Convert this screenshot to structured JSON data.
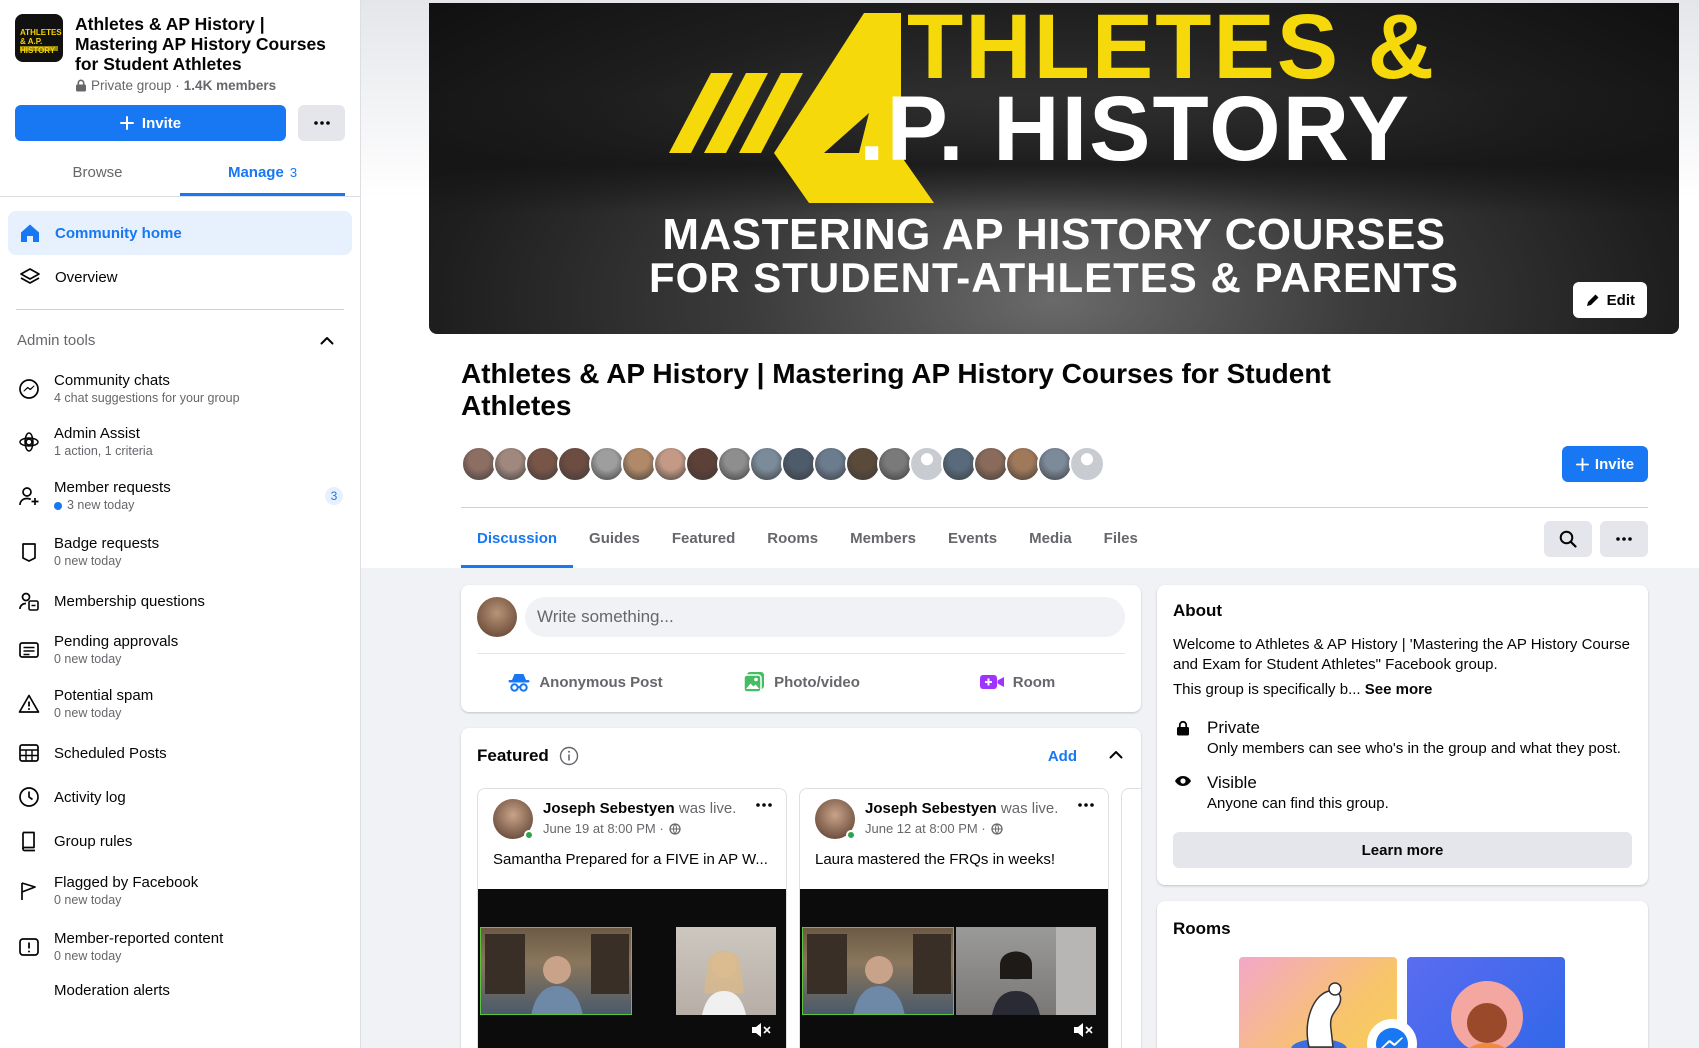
{
  "group": {
    "title": "Athletes & AP History | Mastering AP History Courses for Student Athletes",
    "privacy": "Private group",
    "members": "1.4K members",
    "thumb_text": "ATHLETES & A.P. HISTORY"
  },
  "sidebar": {
    "invite_label": "Invite",
    "tabs": [
      {
        "label": "Browse"
      },
      {
        "label": "Manage",
        "count": "3"
      }
    ],
    "nav": [
      {
        "label": "Community home"
      },
      {
        "label": "Overview"
      }
    ],
    "admin_tools_label": "Admin tools",
    "tools": [
      {
        "label": "Community chats",
        "sub": "4 chat suggestions for your group"
      },
      {
        "label": "Admin Assist",
        "sub": "1 action, 1 criteria"
      },
      {
        "label": "Member requests",
        "sub": "3 new today",
        "badge": "3"
      },
      {
        "label": "Badge requests",
        "sub": "0 new today"
      },
      {
        "label": "Membership questions"
      },
      {
        "label": "Pending approvals",
        "sub": "0 new today"
      },
      {
        "label": "Potential spam",
        "sub": "0 new today"
      },
      {
        "label": "Scheduled Posts"
      },
      {
        "label": "Activity log"
      },
      {
        "label": "Group rules"
      },
      {
        "label": "Flagged by Facebook",
        "sub": "0 new today"
      },
      {
        "label": "Member-reported content",
        "sub": "0 new today"
      },
      {
        "label": "Moderation alerts"
      }
    ]
  },
  "cover": {
    "line1": "THLETES &",
    "line2": ".P. HISTORY",
    "line3": "MASTERING AP HISTORY COURSES",
    "line4": "FOR STUDENT-ATHLETES & PARENTS",
    "edit_label": "Edit"
  },
  "header": {
    "invite_label": "Invite"
  },
  "avatar_colors": [
    "#8d6e63",
    "#a1887f",
    "#795548",
    "#6d4c41",
    "#9e9e9e",
    "#b08968",
    "#c49a86",
    "#5d4037",
    "#8e8e8e",
    "#7b8b9a",
    "#4e5b6b",
    "#6b7c8f",
    "#5a4a3a",
    "#7a7a7a",
    "#c8ccd0",
    "#586a7c",
    "#8a6a5a",
    "#a0785a",
    "#7c8a9a",
    "#c8ccd0"
  ],
  "tabs": [
    "Discussion",
    "Guides",
    "Featured",
    "Rooms",
    "Members",
    "Events",
    "Media",
    "Files"
  ],
  "composer": {
    "placeholder": "Write something...",
    "actions": [
      "Anonymous Post",
      "Photo/video",
      "Room"
    ]
  },
  "featured": {
    "title": "Featured",
    "add_label": "Add",
    "posts": [
      {
        "author": "Joseph Sebestyen",
        "status": "was live.",
        "date": "June 19 at 8:00 PM · ",
        "text": "Samantha Prepared for a FIVE in AP W..."
      },
      {
        "author": "Joseph Sebestyen",
        "status": "was live.",
        "date": "June 12 at 8:00 PM · ",
        "text": "Laura mastered the FRQs in weeks!"
      }
    ]
  },
  "about": {
    "title": "About",
    "description": "Welcome to Athletes & AP History | 'Mastering the AP History Course and Exam for Student Athletes\" Facebook group.",
    "teaser": "This group is specifically b...",
    "see_more": "See more",
    "private_title": "Private",
    "private_desc": "Only members can see who's in the group and what they post.",
    "visible_title": "Visible",
    "visible_desc": "Anyone can find this group.",
    "learn_more": "Learn more"
  },
  "rooms": {
    "title": "Rooms"
  }
}
